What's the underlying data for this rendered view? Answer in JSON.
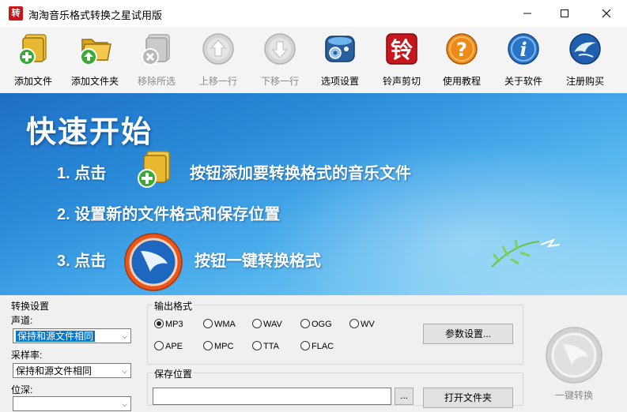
{
  "window": {
    "icon_text": "转",
    "title": "淘淘音乐格式转换之星试用版",
    "minimize": "—",
    "maximize": "☐",
    "close": "✕"
  },
  "toolbar": [
    {
      "label": "添加文件",
      "icon": "add-file-icon",
      "enabled": true
    },
    {
      "label": "添加文件夹",
      "icon": "add-folder-icon",
      "enabled": true
    },
    {
      "label": "移除所选",
      "icon": "remove-icon",
      "enabled": false
    },
    {
      "label": "上移一行",
      "icon": "move-up-icon",
      "enabled": false
    },
    {
      "label": "下移一行",
      "icon": "move-down-icon",
      "enabled": false
    },
    {
      "label": "选项设置",
      "icon": "settings-icon",
      "enabled": true
    },
    {
      "label": "铃声剪切",
      "icon": "ringtone-icon",
      "enabled": true,
      "icon_text": "铃"
    },
    {
      "label": "使用教程",
      "icon": "help-icon",
      "enabled": true,
      "icon_text": "?"
    },
    {
      "label": "关于软件",
      "icon": "info-icon",
      "enabled": true,
      "icon_text": "i"
    },
    {
      "label": "注册购买",
      "icon": "register-icon",
      "enabled": true
    }
  ],
  "banner": {
    "title": "快速开始",
    "step1_prefix": "1. 点击",
    "step1_suffix": "按钮添加要转换格式的音乐文件",
    "step2": "2. 设置新的文件格式和保存位置",
    "step3_prefix": "3. 点击",
    "step3_suffix": "按钮一键转换格式"
  },
  "settings": {
    "group_label": "转换设置",
    "channel_label": "声道:",
    "channel_value": "保持和源文件相同",
    "samplerate_label": "采样率:",
    "samplerate_value": "保持和源文件相同",
    "bitdepth_label": "位深:"
  },
  "output": {
    "group_label": "输出格式",
    "formats": [
      {
        "name": "MP3",
        "checked": true
      },
      {
        "name": "WMA",
        "checked": false
      },
      {
        "name": "WAV",
        "checked": false
      },
      {
        "name": "OGG",
        "checked": false
      },
      {
        "name": "WV",
        "checked": false
      },
      {
        "name": "APE",
        "checked": false
      },
      {
        "name": "MPC",
        "checked": false
      },
      {
        "name": "TTA",
        "checked": false
      },
      {
        "name": "FLAC",
        "checked": false
      }
    ],
    "params_button": "参数设置...",
    "save_label": "保存位置",
    "save_path": "",
    "browse_button": "...",
    "open_folder_button": "打开文件夹"
  },
  "convert": {
    "label": "一键转换"
  },
  "colors": {
    "banner_dark": "#1e6fc4",
    "banner_light": "#9ad8f7",
    "accent_orange": "#e8561c",
    "folder_yellow": "#e8b830",
    "plus_green": "#3aa935"
  }
}
